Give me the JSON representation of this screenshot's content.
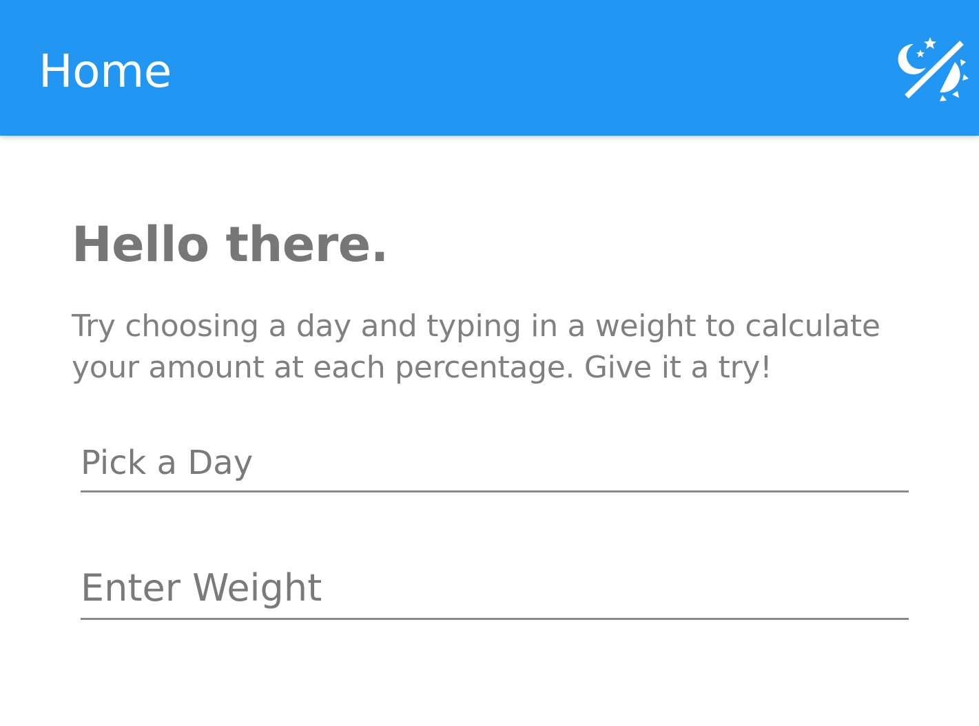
{
  "app_bar": {
    "title": "Home",
    "theme_toggle_icon": "dark-mode-toggle-icon",
    "background_color": "#2196f3"
  },
  "main": {
    "greeting": "Hello there.",
    "intro": "Try choosing a day and typing in a weight to calculate your amount at each percentage. Give it a try!",
    "day_field": {
      "placeholder": "Pick a Day",
      "value": ""
    },
    "weight_field": {
      "placeholder": "Enter Weight",
      "value": ""
    }
  }
}
